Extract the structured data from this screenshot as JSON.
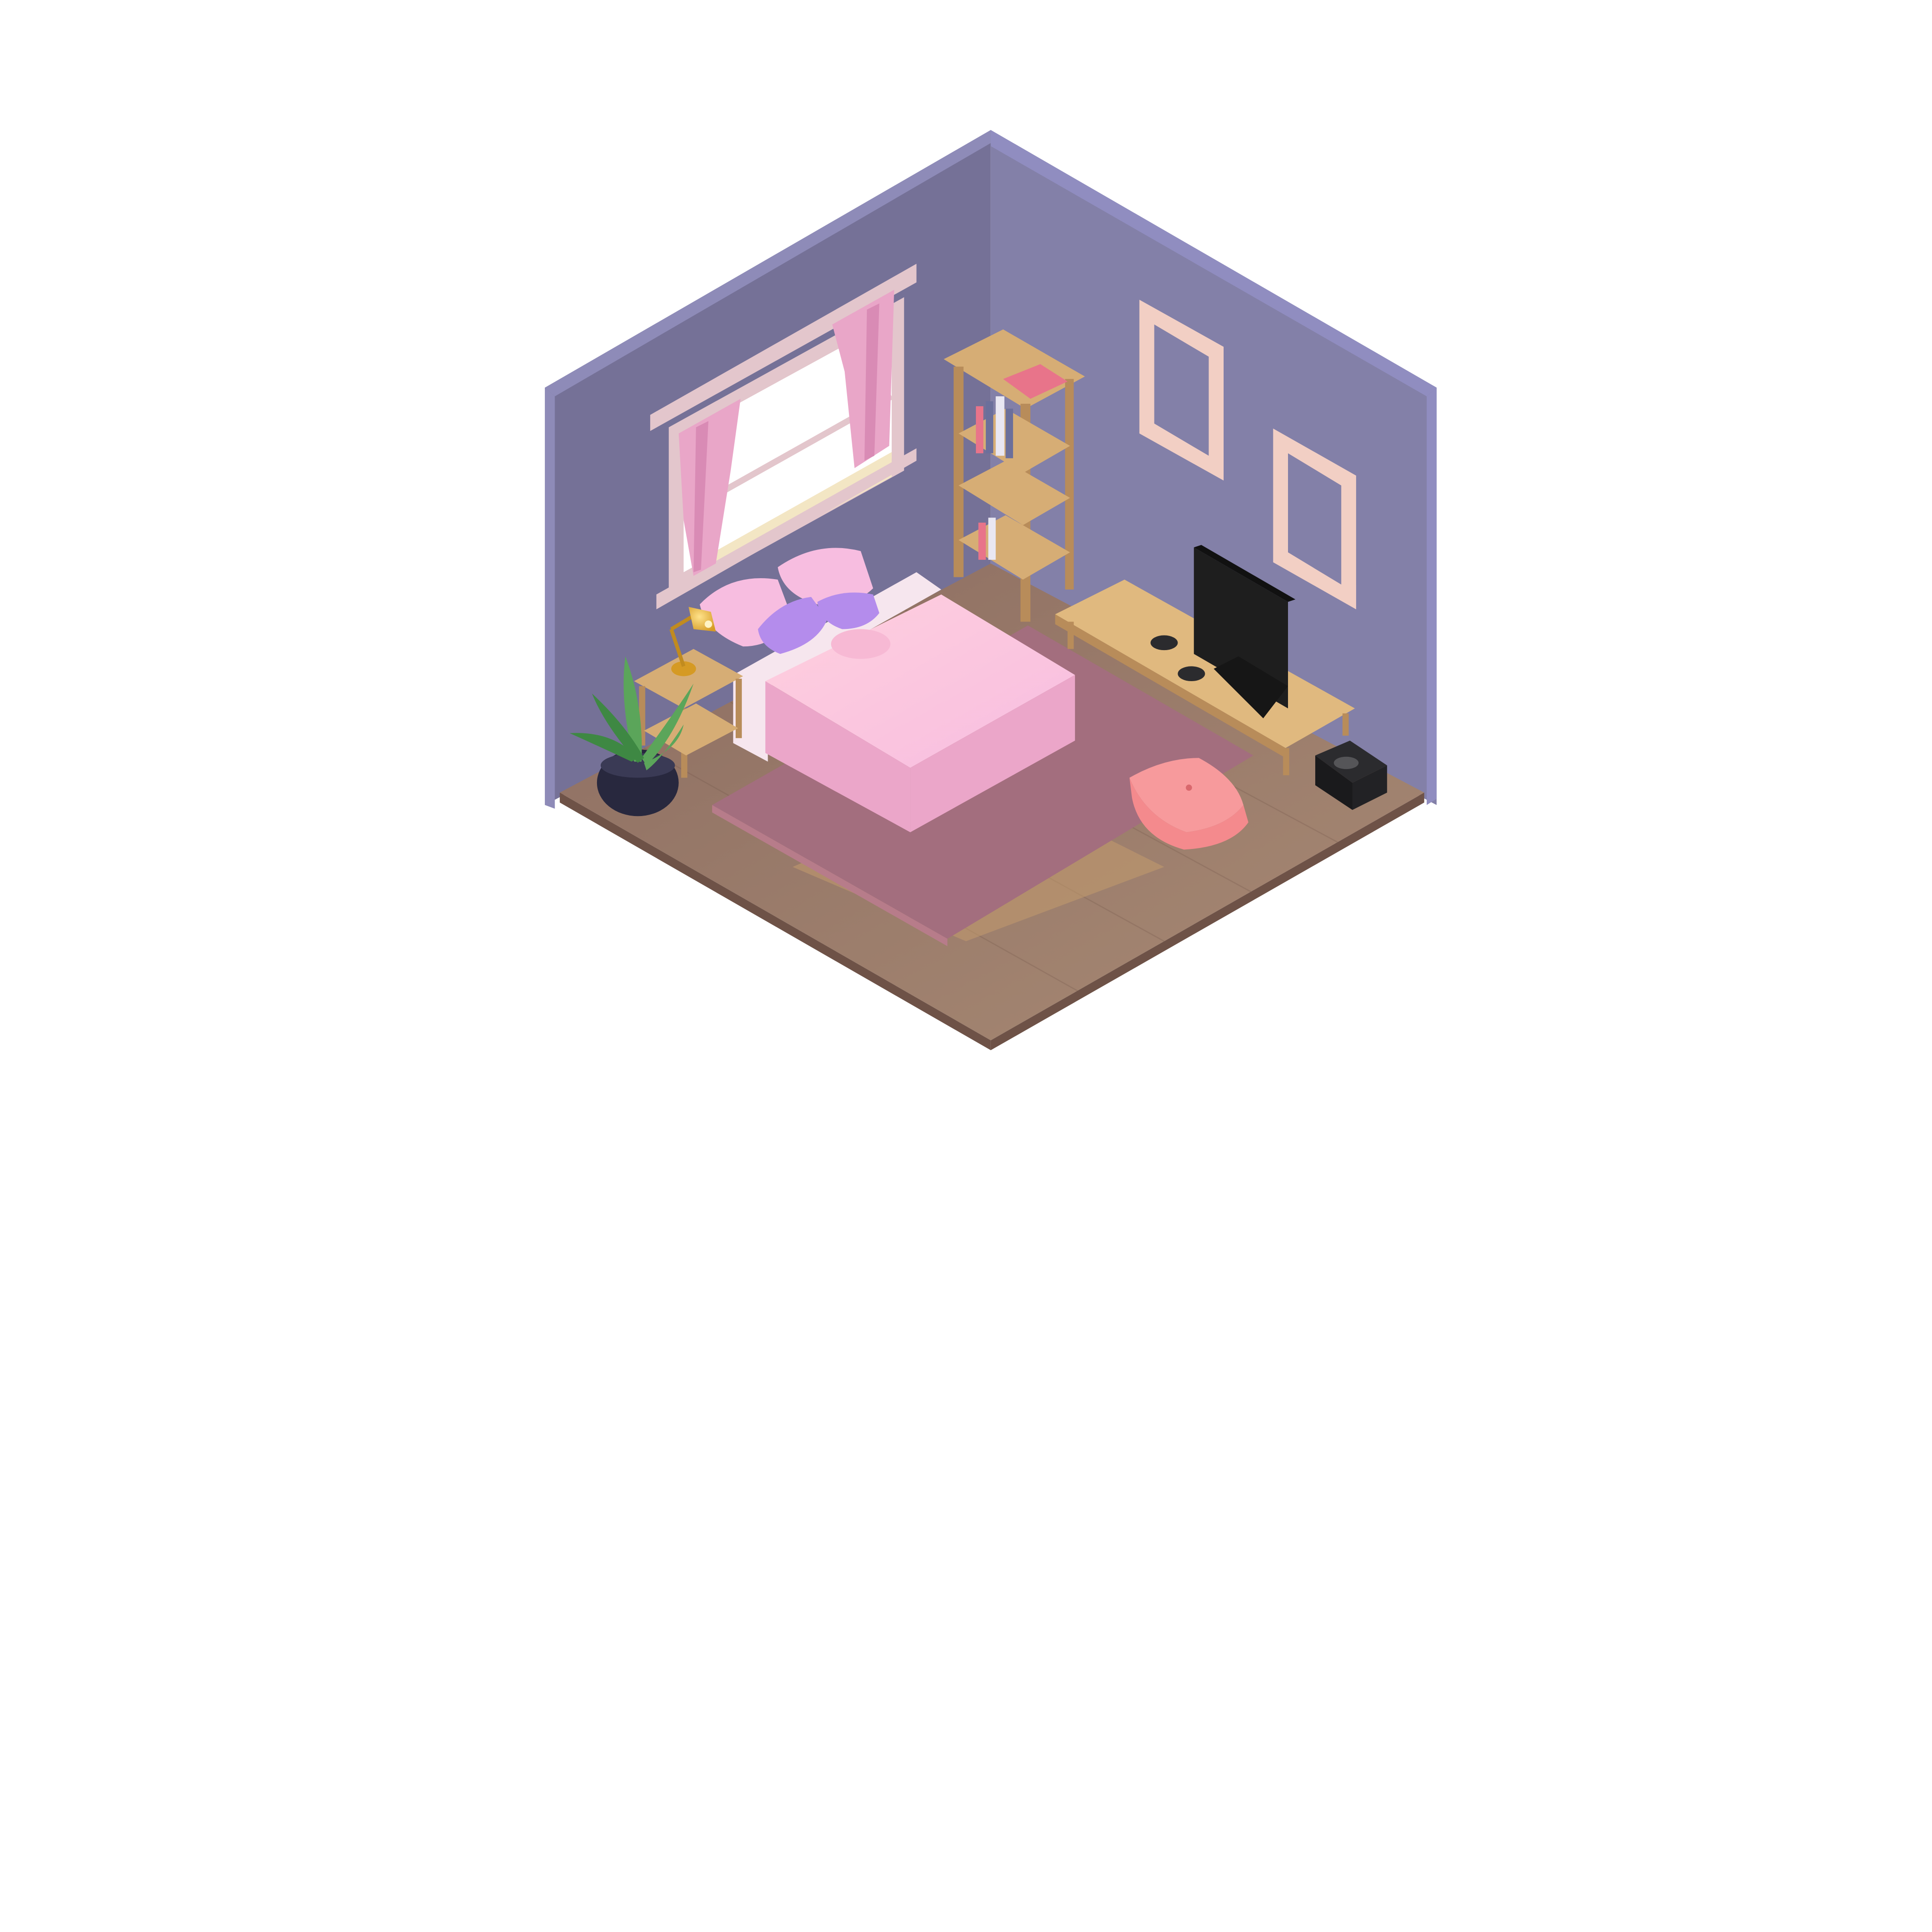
{
  "scene": {
    "description_tag": "",
    "colors": {
      "background": "#ffffff",
      "wall_left": "#757197",
      "wall_right": "#8380a8",
      "wall_top_edge": "#8e8bb8",
      "wall_corner": "#908dc0",
      "floor": "#8c6d61",
      "floor_light": "#a88a74",
      "floor_edge": "#6e5247",
      "rug": "#a36e7e",
      "rug_light": "#b77c8a",
      "window_frame": "#e3c6cc",
      "window_glass": "#ffffff",
      "sill_glow": "#f3e6c4",
      "curtain": "#e9a6c8",
      "curtain_dark": "#d98bb5",
      "bed_frame": "#f6e6ee",
      "blanket_top": "#ffd0de",
      "blanket_side": "#eba6c9",
      "pillow_pink": "#f7bde0",
      "pillow_purple": "#b48cec",
      "wood": "#d6ad75",
      "wood_dark": "#b88c5a",
      "frame": "#f2cfc4",
      "tv": "#1e1e1e",
      "tv_stand": "#e0b97f",
      "cushion": "#f48a8d",
      "cushion_top": "#f79a9c",
      "plant_leaf": "#5ba55a",
      "plant_leaf_dark": "#3e8843",
      "pot": "#28283e",
      "lamp": "#d59a24",
      "console": "#2b2b2e",
      "book_red": "#e8748a",
      "book_blue": "#6b6f9b",
      "book_white": "#e9e7f2"
    },
    "objects": [
      {
        "name": "left-wall",
        "icon": "wall"
      },
      {
        "name": "right-wall",
        "icon": "wall"
      },
      {
        "name": "wooden-floor",
        "icon": "floor"
      },
      {
        "name": "window",
        "icon": "window"
      },
      {
        "name": "curtains",
        "icon": "curtain"
      },
      {
        "name": "bookshelf",
        "icon": "shelf"
      },
      {
        "name": "picture-frames",
        "icon": "frame"
      },
      {
        "name": "bed",
        "icon": "bed"
      },
      {
        "name": "nightstand",
        "icon": "table"
      },
      {
        "name": "desk-lamp",
        "icon": "lamp"
      },
      {
        "name": "potted-plant",
        "icon": "plant"
      },
      {
        "name": "tv-stand",
        "icon": "table"
      },
      {
        "name": "television",
        "icon": "tv"
      },
      {
        "name": "game-controllers",
        "icon": "gamepad"
      },
      {
        "name": "game-console",
        "icon": "console"
      },
      {
        "name": "floor-cushion",
        "icon": "cushion"
      },
      {
        "name": "rug",
        "icon": "rug"
      }
    ]
  }
}
